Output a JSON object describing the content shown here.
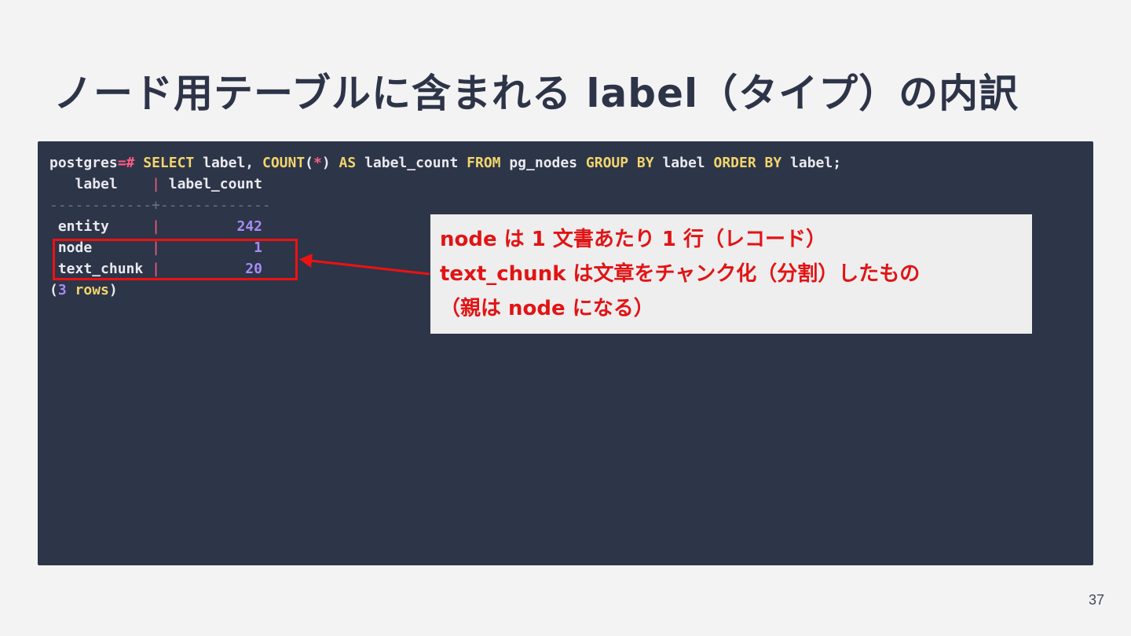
{
  "slide": {
    "title": "ノード用テーブルに含まれる label（タイプ）の内訳",
    "page_number": "37"
  },
  "terminal": {
    "prompt": "postgres=#",
    "query": {
      "select_kw": "SELECT",
      "select_col": "label,",
      "count_fn": "COUNT",
      "paren_open": "(",
      "star": "*",
      "paren_close": ")",
      "as_kw": "AS",
      "alias": "label_count",
      "from_kw": "FROM",
      "table": "pg_nodes",
      "group_kw": "GROUP",
      "group_by_kw": "BY",
      "group_col": "label",
      "order_kw": "ORDER",
      "order_by_kw": "BY",
      "order_col": "label;"
    },
    "table": {
      "headers": [
        "label",
        "label_count"
      ],
      "separator_left": "------------",
      "separator_cross": "+",
      "separator_right": "-------------",
      "rows": [
        {
          "label": "entity",
          "label_count": "242"
        },
        {
          "label": "node",
          "label_count": "1"
        },
        {
          "label": "text_chunk",
          "label_count": "20"
        }
      ],
      "footer": {
        "open": "(",
        "count": "3",
        "word": "rows",
        "close": ")"
      }
    }
  },
  "callout": {
    "lines": [
      "node は 1 文書あたり 1 行（レコード）",
      "text_chunk は文章をチャンク化（分割）したもの",
      "（親は node になる）"
    ],
    "color": "#e11414"
  },
  "colors": {
    "background": "#f3f3f4",
    "terminal_bg": "#2d3548",
    "keyword": "#f2d56b",
    "operator": "#ff5d84",
    "number": "#a58cf4",
    "annotation": "#ec1212"
  }
}
